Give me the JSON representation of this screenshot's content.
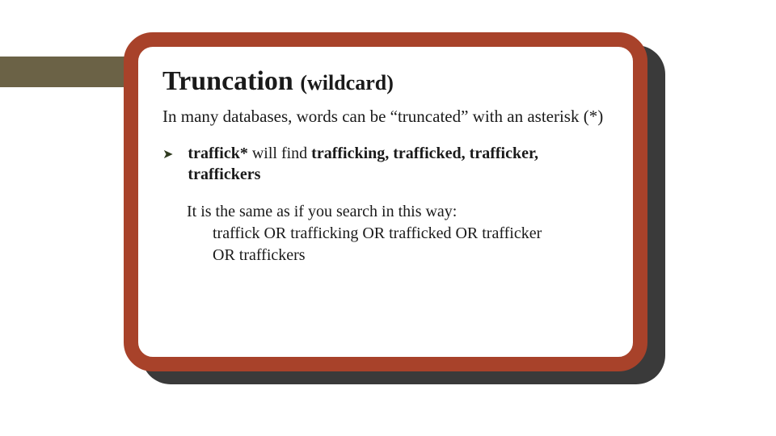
{
  "title": {
    "main": "Truncation",
    "sub": "(wildcard)"
  },
  "intro": "In many databases, words can be “truncated” with an asterisk (*)",
  "bullet": {
    "term": "traffick*",
    "middle": " will find ",
    "results": "trafficking, trafficked, trafficker, traffickers"
  },
  "explain": {
    "line1": "It is the same as if you search in this way:",
    "line2": "traffick OR trafficking OR trafficked OR trafficker",
    "line3": "OR traffickers"
  },
  "glyphs": {
    "arrow": "➤"
  }
}
